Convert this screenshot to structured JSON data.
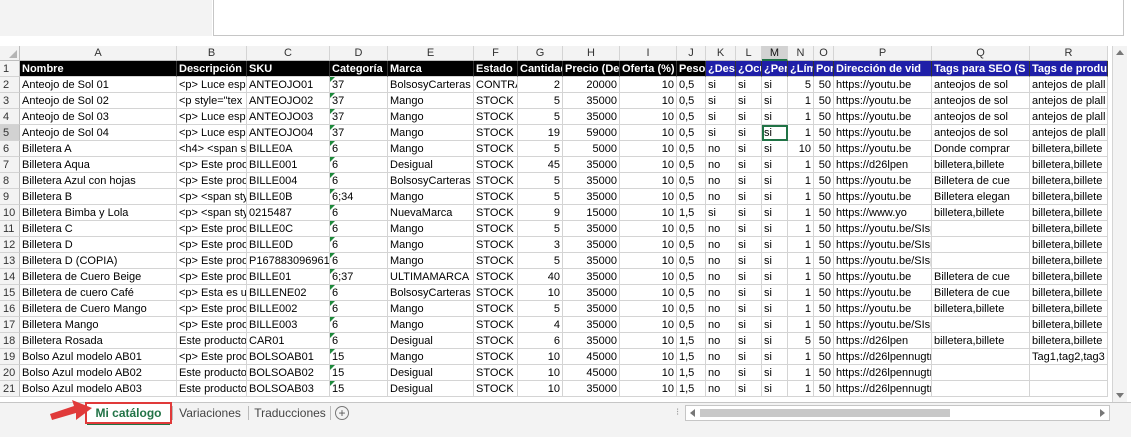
{
  "columns": [
    "A",
    "B",
    "C",
    "D",
    "E",
    "F",
    "G",
    "H",
    "I",
    "J",
    "K",
    "L",
    "M",
    "N",
    "O",
    "P",
    "Q",
    "R"
  ],
  "active_column": "M",
  "active_row": 5,
  "header_row": [
    "Nombre",
    "Descripción",
    "SKU",
    "Categoría",
    "Marca",
    "Estado",
    "Cantidad e",
    "Precio (Dec",
    "Oferta (%)",
    "Peso",
    "¿Dest",
    "¿Ocu",
    "¿Perr",
    "¿Lími",
    "Porce",
    "Dirección de vid",
    "Tags para SEO (S",
    "Tags de produc"
  ],
  "rows": [
    [
      "Anteojo de Sol 01",
      "<p> Luce espe",
      "ANTEOJO01",
      "37",
      "BolsosyCarteras",
      "CONTRA",
      "2",
      "20000",
      "10",
      "0,5",
      "si",
      "si",
      "si",
      "5",
      "50",
      "https://youtu.be",
      "anteojos de sol",
      "antejos de plall"
    ],
    [
      "Anteojo de Sol 02",
      "<p style=\"tex",
      "ANTEOJO02",
      "37",
      "Mango",
      "STOCK",
      "5",
      "35000",
      "10",
      "0,5",
      "si",
      "si",
      "si",
      "1",
      "50",
      "https://youtu.be",
      "anteojos de sol",
      "antejos de plall"
    ],
    [
      "Anteojo de Sol 03",
      "<p> Luce espe",
      "ANTEOJO03",
      "37",
      "Mango",
      "STOCK",
      "5",
      "35000",
      "10",
      "0,5",
      "si",
      "si",
      "si",
      "1",
      "50",
      "https://youtu.be",
      "anteojos de sol",
      "antejos de plall"
    ],
    [
      "Anteojo de Sol 04",
      "<p> Luce espe",
      "ANTEOJO04",
      "37",
      "Mango",
      "STOCK",
      "19",
      "59000",
      "10",
      "0,5",
      "si",
      "si",
      "si",
      "1",
      "50",
      "https://youtu.be",
      "anteojos de sol",
      "antejos de plall"
    ],
    [
      "Billetera A",
      "<h4> <span st",
      "BILLE0A",
      "6",
      "Mango",
      "STOCK",
      "5",
      "5000",
      "10",
      "0,5",
      "no",
      "si",
      "si",
      "10",
      "50",
      "https://youtu.be",
      "Donde comprar",
      "billetera,billete"
    ],
    [
      "Billetera Aqua",
      "<p> Este prod",
      "BILLE001",
      "6",
      "Desigual",
      "STOCK",
      "45",
      "35000",
      "10",
      "0,5",
      "no",
      "si",
      "si",
      "1",
      "50",
      "https://d26lpen",
      "billetera,billete",
      "billetera,billete"
    ],
    [
      "Billetera Azul con hojas",
      "<p> Este prod",
      "BILLE004",
      "6",
      "BolsosyCarteras",
      "STOCK",
      "5",
      "35000",
      "10",
      "0,5",
      "no",
      "si",
      "si",
      "1",
      "50",
      "https://youtu.be",
      "Billetera de cue",
      "billetera,billete"
    ],
    [
      "Billetera B",
      "<p> <span sty",
      "BILLE0B",
      "6;34",
      "Mango",
      "STOCK",
      "5",
      "35000",
      "10",
      "0,5",
      "no",
      "si",
      "si",
      "1",
      "50",
      "https://youtu.be",
      "Billetera elegan",
      "billetera,billete"
    ],
    [
      "Billetera Bimba y Lola",
      "<p> <span sty",
      "0215487",
      "6",
      "NuevaMarca",
      "STOCK",
      "9",
      "15000",
      "10",
      "1,5",
      "si",
      "si",
      "si",
      "1",
      "50",
      "https://www.yo",
      "billetera,billete",
      "billetera,billete"
    ],
    [
      "Billetera C",
      "<p> Este prod",
      "BILLE0C",
      "6",
      "Mango",
      "STOCK",
      "5",
      "35000",
      "10",
      "0,5",
      "no",
      "si",
      "si",
      "1",
      "50",
      "https://youtu.be/SIsp3kFeINw",
      "",
      "billetera,billete"
    ],
    [
      "Billetera D",
      "<p> Este prod",
      "BILLE0D",
      "6",
      "Mango",
      "STOCK",
      "3",
      "35000",
      "10",
      "0,5",
      "no",
      "si",
      "si",
      "1",
      "50",
      "https://youtu.be/SIsp3kFeINw",
      "",
      "billetera,billete"
    ],
    [
      "Billetera D (COPIA)",
      "<p> Este prod",
      "P1678830969614",
      "6",
      "Mango",
      "STOCK",
      "5",
      "35000",
      "10",
      "0,5",
      "no",
      "si",
      "si",
      "1",
      "50",
      "https://youtu.be/SIsp3kFeINw",
      "",
      "billetera,billete"
    ],
    [
      "Billetera de Cuero Beige",
      "<p> Este prod",
      "BILLE01",
      "6;37",
      "ULTIMAMARCA",
      "STOCK",
      "40",
      "35000",
      "10",
      "0,5",
      "no",
      "si",
      "si",
      "1",
      "50",
      "https://youtu.be",
      "Billetera de cue",
      "billetera,billete"
    ],
    [
      "Billetera de cuero Café",
      "<p> Esta es ur",
      "BILLENE02",
      "6",
      "BolsosyCarteras",
      "STOCK",
      "10",
      "35000",
      "10",
      "0,5",
      "no",
      "si",
      "si",
      "1",
      "50",
      "https://youtu.be",
      "Billetera de cue",
      "billetera,billete"
    ],
    [
      "Billetera de Cuero Mango",
      "<p> Este prod",
      "BILLE002",
      "6",
      "Mango",
      "STOCK",
      "5",
      "35000",
      "10",
      "0,5",
      "no",
      "si",
      "si",
      "1",
      "50",
      "https://youtu.be",
      "billetera,billete",
      "billetera,billete"
    ],
    [
      "Billetera Mango",
      "<p> Este prod",
      "BILLE003",
      "6",
      "Mango",
      "STOCK",
      "4",
      "35000",
      "10",
      "0,5",
      "no",
      "si",
      "si",
      "1",
      "50",
      "https://youtu.be/SIsp3kFeINw",
      "",
      "billetera,billete"
    ],
    [
      "Billetera Rosada",
      "Este producto",
      "CAR01",
      "6",
      "Desigual",
      "STOCK",
      "6",
      "35000",
      "10",
      "1,5",
      "no",
      "si",
      "si",
      "5",
      "50",
      "https://d26lpen",
      "billetera,billete",
      "billetera,billete"
    ],
    [
      "Bolso Azul modelo AB01",
      "<p> Este prod",
      "BOLSOAB01",
      "15",
      "Mango",
      "STOCK",
      "10",
      "45000",
      "10",
      "1,5",
      "no",
      "si",
      "si",
      "1",
      "50",
      "https://d26lpennugtm8s.cloudfr",
      "",
      "Tag1,tag2,tag3"
    ],
    [
      "Bolso Azul modelo AB02",
      "Este producto",
      "BOLSOAB02",
      "15",
      "Desigual",
      "STOCK",
      "10",
      "45000",
      "10",
      "1,5",
      "no",
      "si",
      "si",
      "1",
      "50",
      "https://d26lpennugtm8s.cloudfront.net/stores/",
      "",
      ""
    ],
    [
      "Bolso Azul modelo AB03",
      "Este producto",
      "BOLSOAB03",
      "15",
      "Desigual",
      "STOCK",
      "10",
      "35000",
      "10",
      "1,5",
      "no",
      "si",
      "si",
      "1",
      "50",
      "https://d26lpennugtm8s.cloudfront.net/stores/",
      "",
      ""
    ]
  ],
  "tabs": [
    {
      "label": "Mi catálogo",
      "active": true
    },
    {
      "label": "Variaciones",
      "active": false
    },
    {
      "label": "Traducciones",
      "active": false
    }
  ],
  "add_sheet_label": "+",
  "colors": {
    "accent": "#217346",
    "highlight": "#e03a3a",
    "header_bg": "#000000",
    "header_blue": "#1f1fa8"
  }
}
